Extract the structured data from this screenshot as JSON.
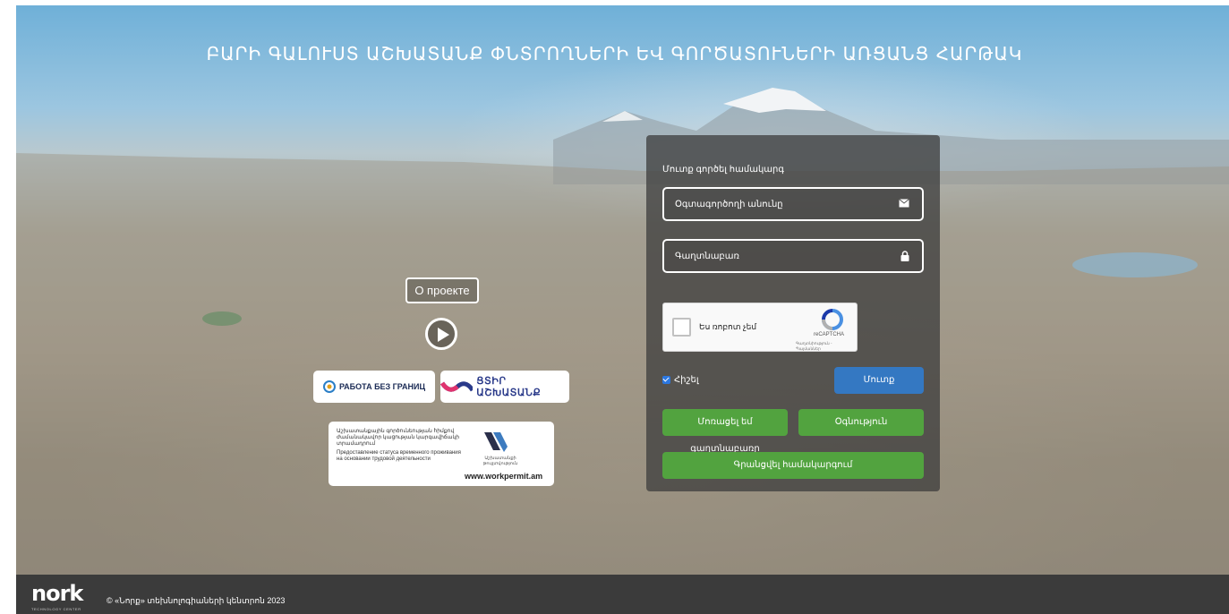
{
  "header": {
    "title": "ԲԱՐԻ ԳԱԼՈՒՍՏ ԱՇԽԱՏԱՆՔ ՓՆՏՐՈՂՆԵՐԻ ԵՎ ԳՈՐԾԱՏՈՒՆԵՐԻ ԱՌՑԱՆՑ ՀԱՐԹԱԿ"
  },
  "promo": {
    "about_label": "О проекте",
    "rabota_logo_text": "РАБОТА БЕЗ ГРАНИЦ",
    "cyr_logo_text": "ՑՏԻՐ ԱՇԽԱՏԱՆՔ",
    "workpermit": {
      "text_am": "Աշխատանքային գործունեության հիմքով ժամանակավոր կացության կարգավիճակի տրամադրում",
      "text_ru": "Предоставление статуса временного проживания на основании трудовой деятельности",
      "logo_caption": "Աշխատանքի թույլտվություն",
      "url": "www.workpermit.am"
    }
  },
  "login": {
    "title": "Մուտք գործել համակարգ",
    "username_placeholder": "Օգտագործողի անունը",
    "password_placeholder": "Գաղտնաբառ",
    "captcha": {
      "label": "Ես ռոբոտ չեմ",
      "brand": "reCAPTCHA",
      "terms": "Գաղտնիություն - Պայմաններ"
    },
    "remember_label": "Հիշել",
    "login_button": "Մուտք",
    "forgot_button": "Մոռացել եմ գաղտնաբառը",
    "help_button": "Օգնություն",
    "register_button": "Գրանցվել համակարգում"
  },
  "footer": {
    "brand": "nork",
    "brand_sub": "TECHNOLOGY CENTER",
    "copyright": "© «Նորք» տեխնոլոգիաների կենտրոն 2023"
  },
  "colors": {
    "login_blue": "#3478c2",
    "action_green": "#52a33f",
    "panel_bg": "#3c3c3c",
    "footer_bg": "#3b3b3b"
  },
  "icons": {
    "username": "envelope-icon",
    "password": "lock-icon",
    "play": "play-icon"
  }
}
